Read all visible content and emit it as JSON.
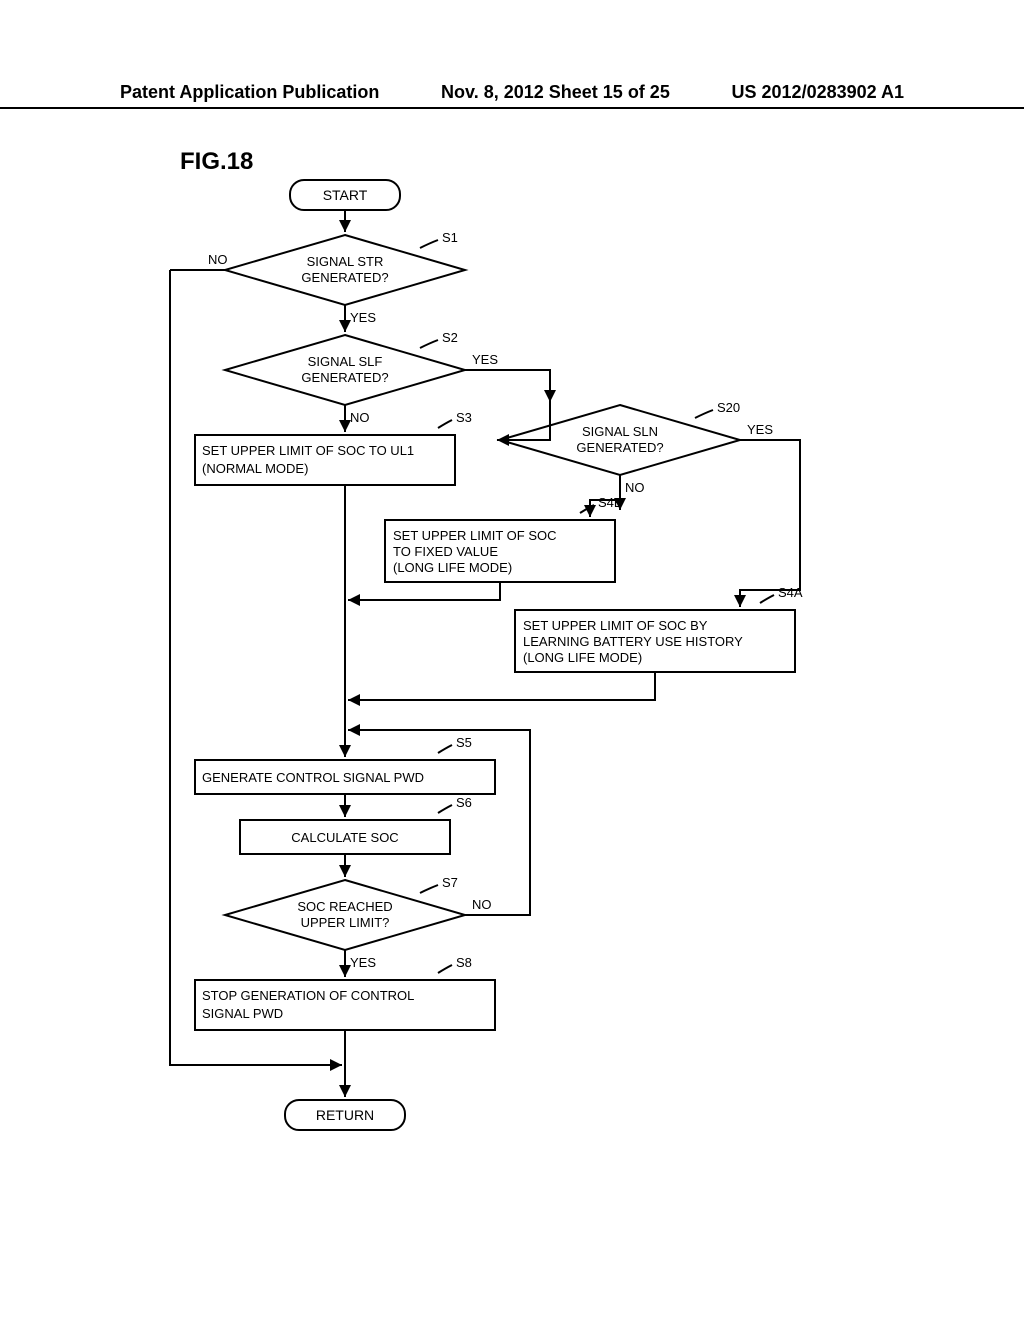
{
  "header": {
    "left": "Patent Application Publication",
    "center": "Nov. 8, 2012  Sheet 15 of 25",
    "right": "US 2012/0283902 A1"
  },
  "figure_label": "FIG.18",
  "terminator": {
    "start": "START",
    "return": "RETURN"
  },
  "decisions": {
    "s1": {
      "text_l1": "SIGNAL STR",
      "text_l2": "GENERATED?",
      "yes": "YES",
      "no": "NO",
      "tag": "S1"
    },
    "s2": {
      "text_l1": "SIGNAL SLF",
      "text_l2": "GENERATED?",
      "yes": "YES",
      "no": "NO",
      "tag": "S2"
    },
    "s7": {
      "text_l1": "SOC REACHED",
      "text_l2": "UPPER LIMIT?",
      "yes": "YES",
      "no": "NO",
      "tag": "S7"
    },
    "s20": {
      "text_l1": "SIGNAL SLN",
      "text_l2": "GENERATED?",
      "yes": "YES",
      "no": "NO",
      "tag": "S20"
    }
  },
  "processes": {
    "s3": {
      "l1": "SET UPPER LIMIT OF SOC TO UL1",
      "l2": "(NORMAL MODE)",
      "tag": "S3"
    },
    "s4b": {
      "l1": "SET UPPER LIMIT OF SOC",
      "l2": "TO FIXED VALUE",
      "l3": "(LONG LIFE MODE)",
      "tag": "S4B"
    },
    "s4a": {
      "l1": "SET UPPER LIMIT OF SOC BY",
      "l2": "LEARNING BATTERY USE HISTORY",
      "l3": "(LONG LIFE MODE)",
      "tag": "S4A"
    },
    "s5": {
      "l1": "GENERATE CONTROL SIGNAL PWD",
      "tag": "S5"
    },
    "s6": {
      "l1": "CALCULATE SOC",
      "tag": "S6"
    },
    "s8": {
      "l1": "STOP GENERATION OF CONTROL",
      "l2": "SIGNAL PWD",
      "tag": "S8"
    }
  }
}
